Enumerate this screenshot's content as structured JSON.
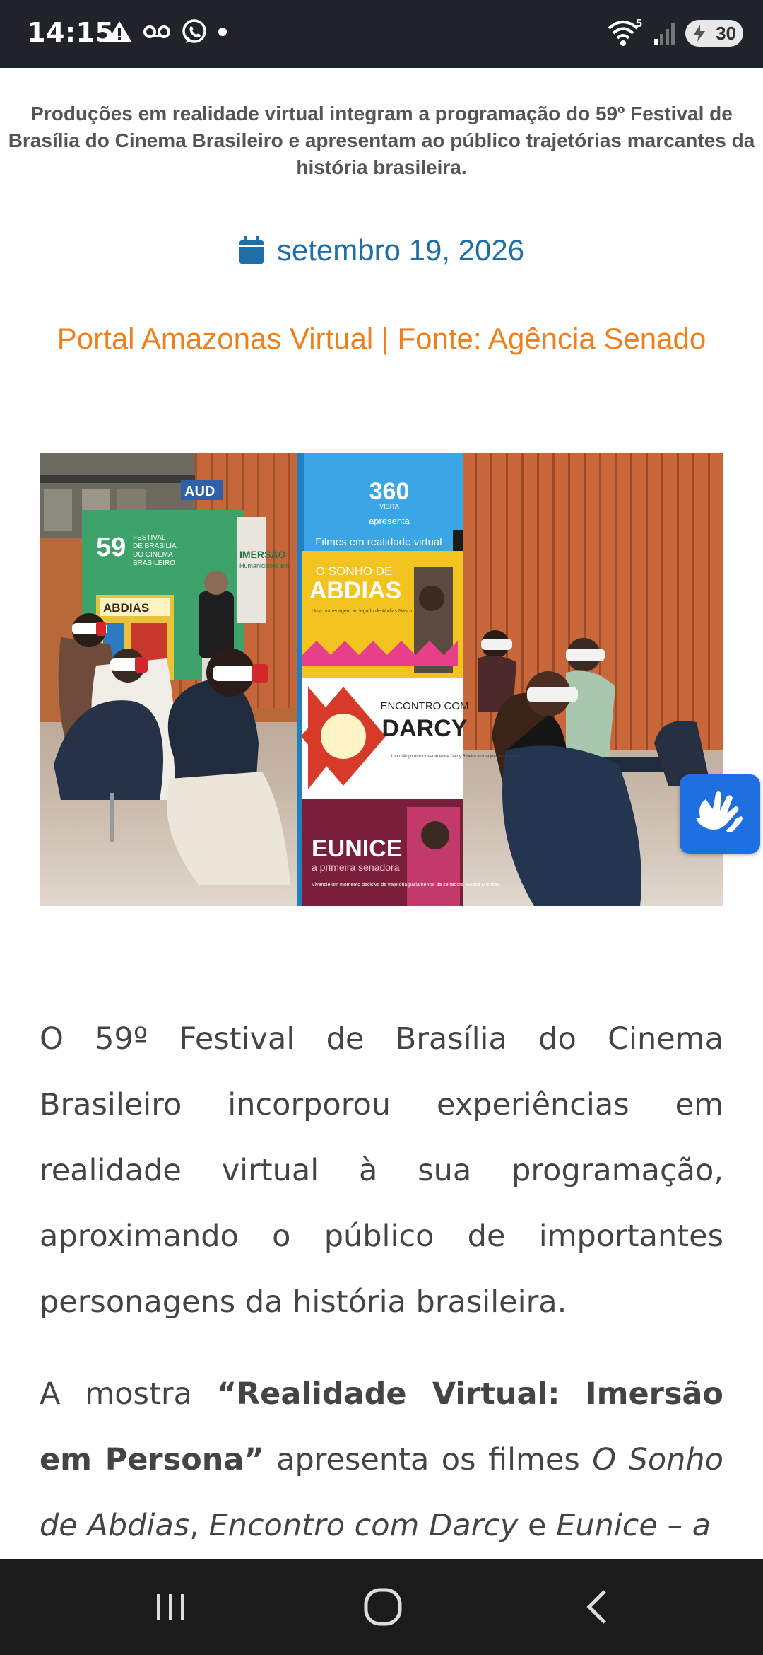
{
  "status_bar": {
    "time": "14:15",
    "network_badge": "5",
    "battery_level": "30"
  },
  "article": {
    "subtitle": "Produções em realidade virtual integram a programação do 59º Festival de Brasília do Cinema Brasileiro e apresentam ao público trajetórias marcantes da história brasileira.",
    "date": "setembro 19, 2026",
    "source": "Portal Amazonas Virtual | Fonte: Agência Senado",
    "paragraph1": "O 59º Festival de Brasília do Cinema Brasileiro incorporou experiências em realidade virtual à sua programação, aproximando o público de importantes personagens da história brasileira.",
    "p2_part1": "A mostra ",
    "p2_bold": "“Realidade Virtual: Imersão em Persona”",
    "p2_part2": " apresenta os filmes ",
    "p2_film1": "O Sonho de Abdias",
    "p2_sep1": ", ",
    "p2_film2": "Encontro com Darcy",
    "p2_sep2": " e ",
    "p2_film3": "Eunice – a"
  },
  "photo": {
    "banner_logo": "360",
    "banner_logo_sub": "VISITA",
    "banner_apresenta": "apresenta",
    "banner_heading": "Filmes em realidade virtual",
    "film1_top": "O SONHO DE",
    "film1_title": "ABDIAS",
    "film1_caption": "Uma homenagem ao legado de Abdias Nascimento.",
    "film2_top": "ENCONTRO COM",
    "film2_title": "DARCY",
    "film2_caption": "Um diálogo emocionante entre Darcy Ribeiro e uma jovem indígena.",
    "film3_title": "EUNICE",
    "film3_sub": "a primeira senadora",
    "film3_caption": "Vivencie um momento decisivo da trajetória parlamentar da senadora Eunice Michiles.",
    "backdrop_number": "59",
    "backdrop_lines": [
      "FESTIVAL",
      "DE BRASÍLIA",
      "DO CINEMA",
      "BRASILEIRO"
    ],
    "backdrop_title": "IMERSÃO",
    "backdrop_sub": "Humanidades em",
    "poster_label": "ABDIAS",
    "sign_label": "AUD"
  },
  "colors": {
    "date_blue": "#1e6fa8",
    "source_orange": "#ef7f1a",
    "accessibility_blue": "#1f6fe0"
  },
  "icons": [
    "warning-icon",
    "voicemail-icon",
    "whatsapp-icon",
    "dot-icon",
    "wifi-icon",
    "signal-icon",
    "battery-icon",
    "calendar-icon",
    "sign-language-icon",
    "recents-icon",
    "home-icon",
    "back-icon"
  ]
}
